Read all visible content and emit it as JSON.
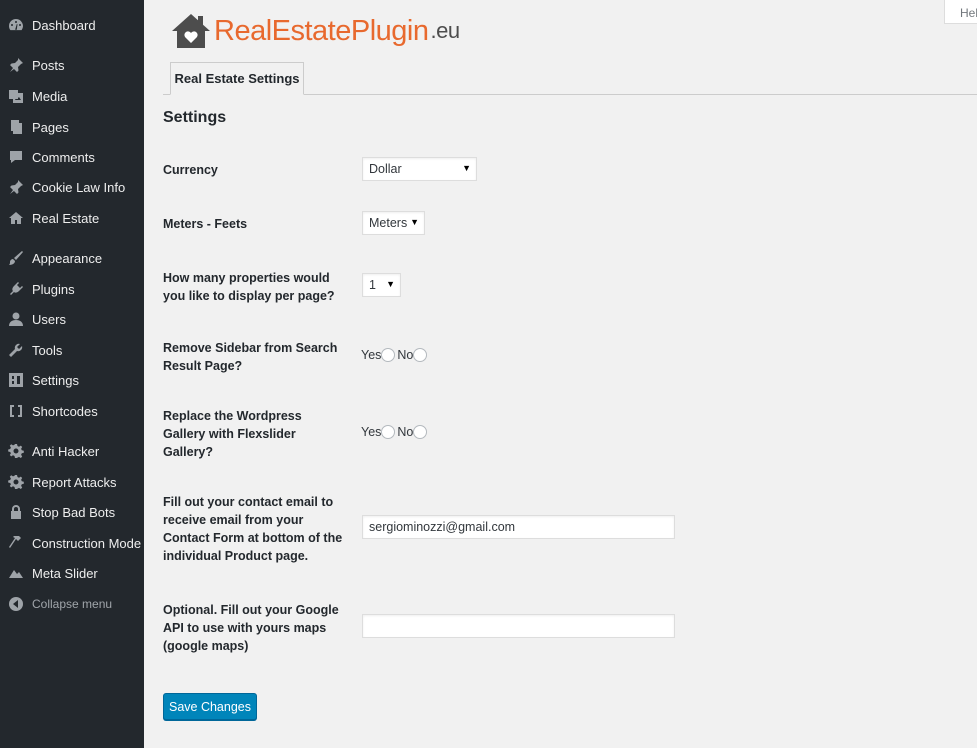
{
  "sidebar": {
    "items": [
      {
        "label": "Dashboard",
        "icon": "dashboard-icon"
      },
      {
        "label": "Posts",
        "icon": "pin-icon"
      },
      {
        "label": "Media",
        "icon": "media-icon"
      },
      {
        "label": "Pages",
        "icon": "pages-icon"
      },
      {
        "label": "Comments",
        "icon": "comments-icon"
      },
      {
        "label": "Cookie Law Info",
        "icon": "pin-icon"
      },
      {
        "label": "Real Estate",
        "icon": "home-icon"
      },
      {
        "label": "Appearance",
        "icon": "brush-icon"
      },
      {
        "label": "Plugins",
        "icon": "plugin-icon"
      },
      {
        "label": "Users",
        "icon": "user-icon"
      },
      {
        "label": "Tools",
        "icon": "wrench-icon"
      },
      {
        "label": "Settings",
        "icon": "settings-icon"
      },
      {
        "label": "Shortcodes",
        "icon": "brackets-icon"
      },
      {
        "label": "Anti Hacker",
        "icon": "gear-icon"
      },
      {
        "label": "Report Attacks",
        "icon": "gear-icon"
      },
      {
        "label": "Stop Bad Bots",
        "icon": "lock-icon"
      },
      {
        "label": "Construction Mode",
        "icon": "hammer-icon"
      },
      {
        "label": "Meta Slider",
        "icon": "mountain-icon"
      },
      {
        "label": "Collapse menu",
        "icon": "collapse-icon"
      }
    ]
  },
  "header": {
    "help_label": "Help",
    "logo_text_main": "RealEstatePlugin",
    "logo_text_ext": ".eu"
  },
  "tabs": [
    {
      "label": "Real Estate Settings"
    }
  ],
  "main": {
    "heading": "Settings",
    "currency": {
      "label": "Currency",
      "value": "Dollar"
    },
    "units": {
      "label": "Meters - Feets",
      "value": "Meters"
    },
    "per_page": {
      "label": "How many properties would you like to display per page?",
      "value": "1"
    },
    "remove_sidebar": {
      "label": "Remove Sidebar from Search Result Page?",
      "yes": "Yes",
      "no": "No"
    },
    "replace_gallery": {
      "label": "Replace the Wordpress Gallery with Flexslider Gallery?",
      "yes": "Yes",
      "no": "No"
    },
    "contact_email": {
      "label": "Fill out your contact email to receive email from your Contact Form at bottom of the individual Product page.",
      "value": "sergiominozzi@gmail.com"
    },
    "google_api": {
      "label": "Optional. Fill out your Google API to use with yours maps (google maps)",
      "value": ""
    },
    "save_label": "Save Changes"
  },
  "colors": {
    "sidebar_bg": "#23282d",
    "page_bg": "#f1f1f1",
    "primary_button": "#0085ba",
    "logo_orange": "#e8692e",
    "logo_gray": "#4d4d4d"
  }
}
